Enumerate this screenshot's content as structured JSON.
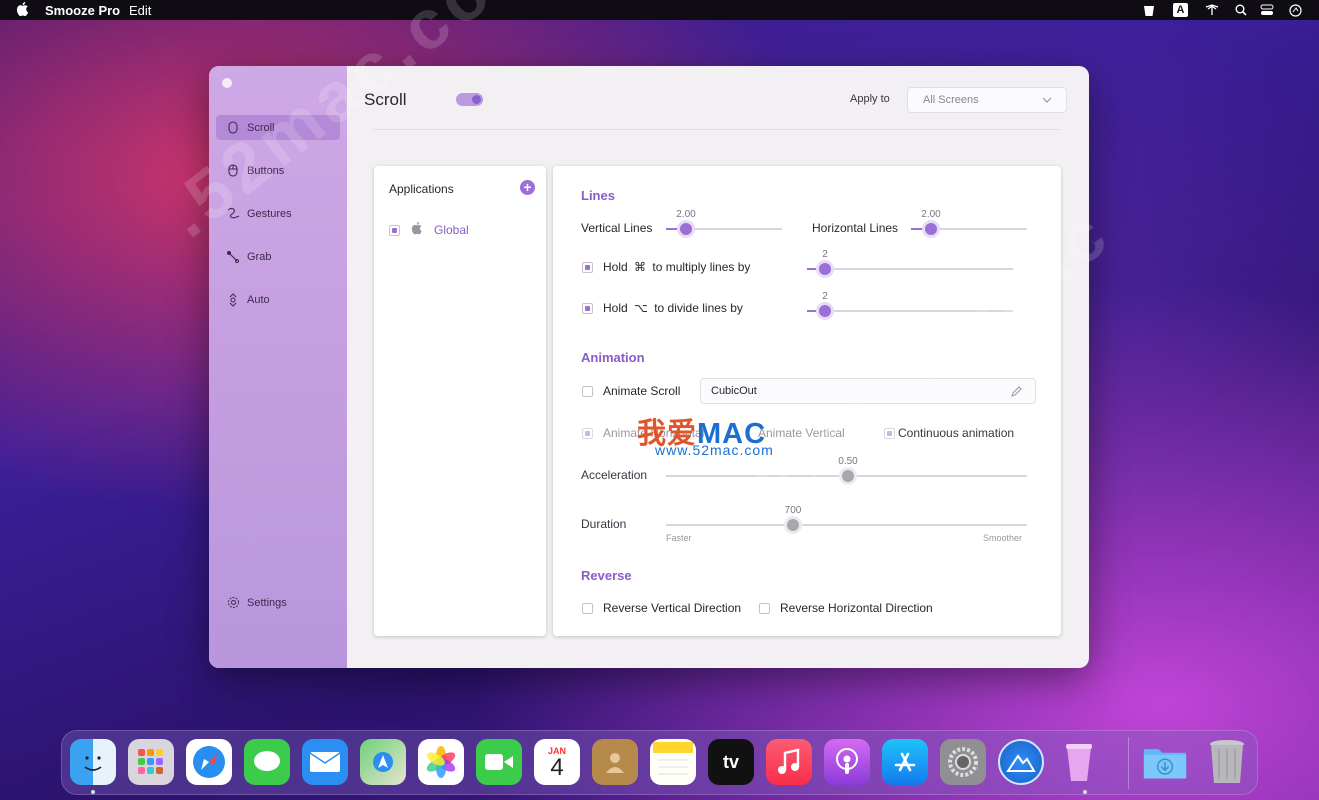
{
  "menubar": {
    "app_name": "Smooze Pro",
    "edit": "Edit"
  },
  "sidebar": {
    "items": [
      {
        "label": "Scroll",
        "icon": "mouse-icon"
      },
      {
        "label": "Buttons",
        "icon": "mouse-icon"
      },
      {
        "label": "Gestures",
        "icon": "gesture-icon"
      },
      {
        "label": "Grab",
        "icon": "grab-icon"
      },
      {
        "label": "Auto",
        "icon": "auto-icon"
      }
    ],
    "settings_label": "Settings"
  },
  "header": {
    "title": "Scroll",
    "apply_to_label": "Apply to",
    "apply_to_value": "All Screens"
  },
  "apps_panel": {
    "title": "Applications",
    "items": [
      {
        "label": "Global"
      }
    ]
  },
  "lines": {
    "heading": "Lines",
    "vertical_label": "Vertical Lines",
    "vertical_value": "2.00",
    "horizontal_label": "Horizontal Lines",
    "horizontal_value": "2.00",
    "hold_cmd_prefix": "Hold",
    "hold_cmd_symbol": "⌘",
    "hold_cmd_suffix": "to multiply lines by",
    "hold_cmd_value": "2",
    "hold_opt_prefix": "Hold",
    "hold_opt_symbol": "⌥",
    "hold_opt_suffix": "to divide lines by",
    "hold_opt_value": "2"
  },
  "animation": {
    "heading": "Animation",
    "animate_scroll_label": "Animate Scroll",
    "easing_value": "CubicOut",
    "animate_horizontal_label": "Animate Horizontal",
    "animate_vertical_label": "Animate Vertical",
    "continuous_label": "Continuous animation",
    "acceleration_label": "Acceleration",
    "acceleration_value": "0.50",
    "duration_label": "Duration",
    "duration_value": "700",
    "duration_min_label": "Faster",
    "duration_max_label": "Smoother"
  },
  "reverse": {
    "heading": "Reverse",
    "vertical_label": "Reverse Vertical Direction",
    "horizontal_label": "Reverse Horizontal Direction"
  },
  "watermark": {
    "text1": ".52mac.com",
    "text2": "www.52mac",
    "logo_cn": "我爱",
    "logo_en": "MAC",
    "url": "www.52mac.com"
  },
  "dock": {
    "calendar_month": "JAN",
    "calendar_day": "4",
    "tv_label": "tv",
    "apps": [
      "finder-icon",
      "launchpad-icon",
      "safari-icon",
      "messages-icon",
      "mail-icon",
      "maps-icon",
      "photos-icon",
      "facetime-icon",
      "calendar-icon",
      "contacts-icon",
      "notes-icon",
      "appletv-icon",
      "music-icon",
      "podcasts-icon",
      "appstore-icon",
      "system-preferences-icon",
      "smooze-icon",
      "cup-icon",
      "downloads-icon",
      "trash-icon"
    ]
  }
}
